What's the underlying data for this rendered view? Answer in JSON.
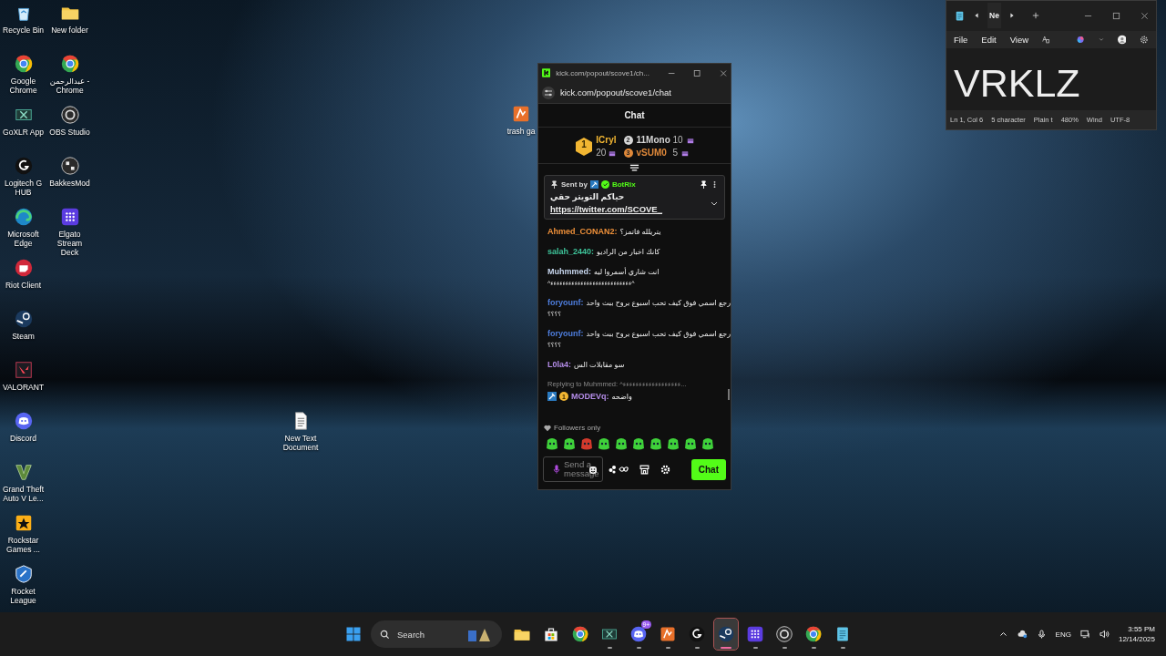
{
  "desktop": {
    "icons": [
      {
        "label": "Recycle Bin",
        "kind": "recycle"
      },
      {
        "label": "Google Chrome",
        "kind": "chrome"
      },
      {
        "label": "GoXLR App",
        "kind": "goxlr"
      },
      {
        "label": "Logitech G HUB",
        "kind": "logitech"
      },
      {
        "label": "Microsoft Edge",
        "kind": "edge"
      },
      {
        "label": "Riot Client",
        "kind": "riot"
      },
      {
        "label": "Steam",
        "kind": "steam"
      },
      {
        "label": "VALORANT",
        "kind": "valorant"
      },
      {
        "label": "Discord",
        "kind": "discord"
      },
      {
        "label": "Grand Theft Auto V Le...",
        "kind": "gta"
      },
      {
        "label": "Rockstar Games ...",
        "kind": "rockstar"
      },
      {
        "label": "Rocket League",
        "kind": "rocket"
      },
      {
        "label": "New folder",
        "kind": "folder"
      },
      {
        "label": "عبدالرحمن - Chrome",
        "kind": "chrome"
      },
      {
        "label": "OBS Studio",
        "kind": "obs"
      },
      {
        "label": "BakkesMod",
        "kind": "bakkes"
      },
      {
        "label": "Elgato Stream Deck",
        "kind": "elgato"
      }
    ],
    "loose_icons": [
      {
        "label": "trash ga",
        "kind": "app"
      },
      {
        "label": "New Text Document",
        "kind": "textfile"
      }
    ]
  },
  "chat_window": {
    "title": "kick.com/popout/scove1/ch...",
    "address": "kick.com/popout/scove1/chat",
    "header": "Chat",
    "leaderboard": [
      {
        "rank": "1",
        "name": "ICryl",
        "count": "20",
        "color": "#f2b632"
      },
      {
        "rank": "2",
        "name": "11Mono",
        "count": "10",
        "color": "#d6d6d6"
      },
      {
        "rank": "3",
        "name": "vSUM0",
        "count": "5",
        "color": "#e0893a"
      }
    ],
    "pinned": {
      "sent_by": "Sent by",
      "author": "BotRix",
      "text": "حياكم التويتر حقي",
      "link": "https://twitter.com/SCOVE_"
    },
    "messages": [
      {
        "user": "Ahmed_CONAN2:",
        "color": "#f0913a",
        "text": "يتريلله فاتمز؟"
      },
      {
        "user": "salah_2440:",
        "color": "#3ec49a",
        "text": "كانك اخبار من الراديو"
      },
      {
        "user": "Muhmmed:",
        "color": "#c9d8f0",
        "text": "انت شاري أسمروا ليه",
        "continuation": "^ءءءءءءءءءءءءءءءءءءءءءءءءءءء^"
      },
      {
        "user": "foryounf:",
        "color": "#4f7fe0",
        "text": "رجع اسمي فوق كيف تحب اسبوع بروح ببث واحد",
        "continuation": "؟؟؟؟"
      },
      {
        "user": "foryounf:",
        "color": "#4f7fe0",
        "text": "رجع اسمي فوق كيف تحب اسبوع بروح ببث واحد",
        "continuation": "؟؟؟؟"
      },
      {
        "user": "L0la4:",
        "color": "#b48ce8",
        "text": "سو مقابلات الس"
      },
      {
        "reply_to": "Replying to Muhmmed: ^ءءءءءءءءءءءءءءءءءء...",
        "user": "MODEVq:",
        "color": "#b48ce8",
        "badge": "1",
        "text": "واضحه"
      }
    ],
    "followers_only": "Followers only",
    "placeholder": "Send a message",
    "send_button": "Chat"
  },
  "notepad": {
    "tab": "Ne",
    "menu": [
      "File",
      "Edit",
      "View"
    ],
    "content": "VRKLZ",
    "status": [
      "Ln 1, Col 6",
      "5 character",
      "Plain t",
      "480%",
      "Wind",
      "UTF-8"
    ]
  },
  "taskbar": {
    "search": "Search",
    "apps": [
      {
        "kind": "folder",
        "running": false,
        "selected": false
      },
      {
        "kind": "store",
        "running": false,
        "selected": false
      },
      {
        "kind": "chrome",
        "running": false,
        "selected": false
      },
      {
        "kind": "goxlr",
        "running": true,
        "selected": false
      },
      {
        "kind": "discord",
        "running": true,
        "selected": false,
        "badge": "9+"
      },
      {
        "kind": "app",
        "running": true,
        "selected": false
      },
      {
        "kind": "logitech",
        "running": true,
        "selected": false
      },
      {
        "kind": "steam",
        "running": true,
        "selected": true
      },
      {
        "kind": "elgato",
        "running": true,
        "selected": false
      },
      {
        "kind": "obs",
        "running": true,
        "selected": false
      },
      {
        "kind": "chrome",
        "running": true,
        "selected": false
      },
      {
        "kind": "notepad",
        "running": true,
        "selected": false
      }
    ],
    "language": "ENG",
    "time": "3:55 PM",
    "date": "12/14/2025"
  }
}
